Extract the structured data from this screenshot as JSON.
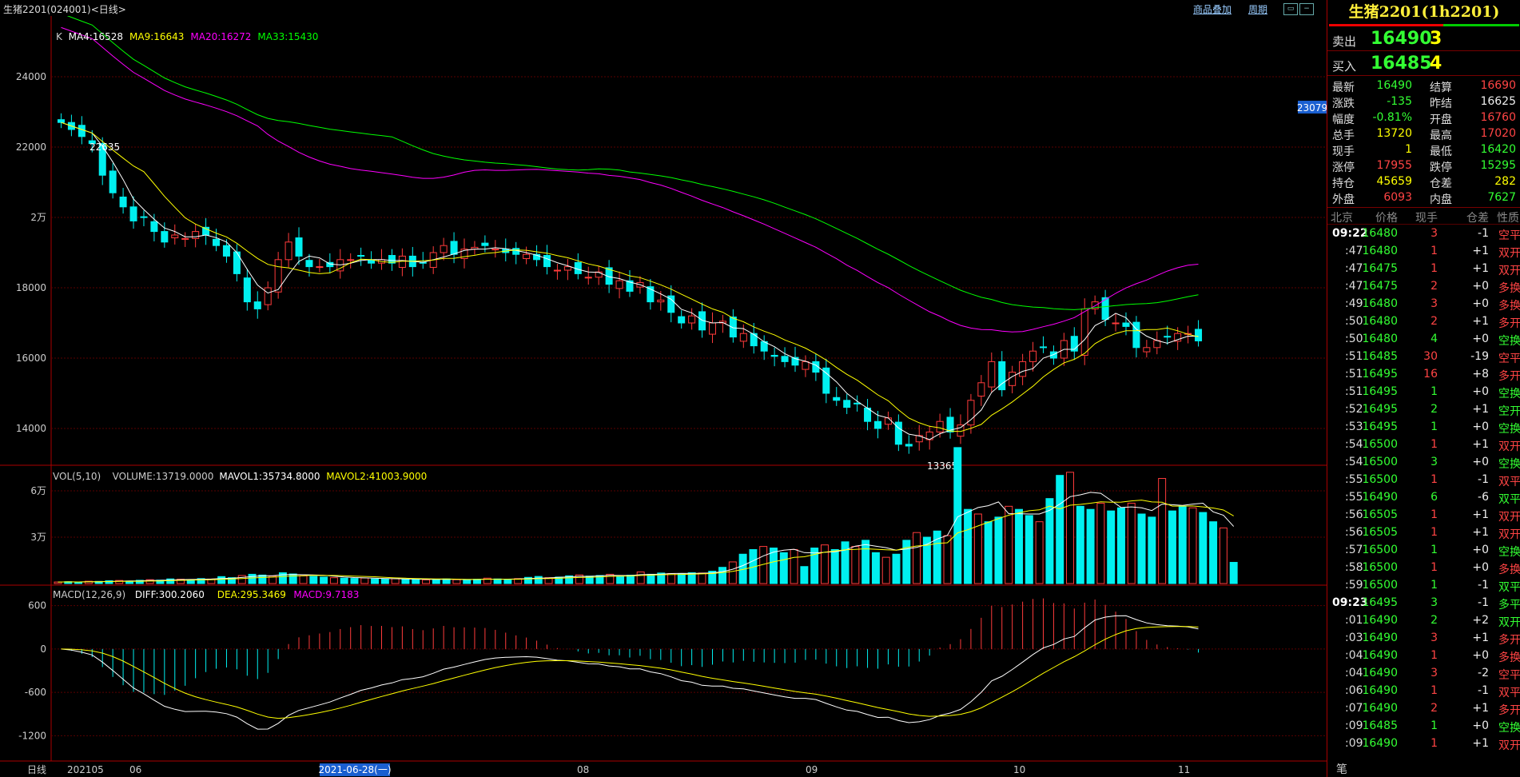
{
  "window": {
    "title": "生猪2201(024001)<日线>",
    "link_overlay": "商品叠加",
    "link_period": "周期"
  },
  "chart_data": {
    "type": "candlestick",
    "period": "日线",
    "price_axis": {
      "ticks": [
        "24000",
        "22000",
        "2万",
        "18000",
        "16000",
        "14000"
      ],
      "values": [
        24000,
        22000,
        20000,
        18000,
        16000,
        14000
      ],
      "ylim": [
        13000,
        25500
      ]
    },
    "ma_legend": [
      {
        "text": "K",
        "color": "#cccccc"
      },
      {
        "text": "MA4:16528",
        "color": "#ffffff"
      },
      {
        "text": "MA9:16643",
        "color": "#ffff00"
      },
      {
        "text": "MA20:16272",
        "color": "#ff00ff"
      },
      {
        "text": "MA33:15430",
        "color": "#00ff00"
      }
    ],
    "high_marker": "22635",
    "low_marker": "13365",
    "price_cursor": "23079",
    "closes": [
      22700,
      22500,
      22300,
      22100,
      21200,
      20700,
      20300,
      19900,
      20000,
      19600,
      19300,
      19500,
      19400,
      19600,
      19500,
      19200,
      18900,
      18400,
      17600,
      17400,
      18000,
      18800,
      19300,
      18900,
      18600,
      18600,
      18600,
      18800,
      18800,
      18900,
      18700,
      18800,
      18700,
      18900,
      18600,
      18700,
      19000,
      19200,
      18950,
      19100,
      19150,
      19200,
      19100,
      19000,
      18950,
      18950,
      18800,
      18600,
      18500,
      18600,
      18400,
      18300,
      18450,
      18100,
      18200,
      17900,
      18150,
      17600,
      17650,
      17300,
      17000,
      17200,
      16800,
      17000,
      17050,
      16600,
      16700,
      16350,
      16200,
      16050,
      15900,
      15800,
      15900,
      15600,
      15000,
      14800,
      14600,
      14700,
      14200,
      14000,
      14300,
      13550,
      13500,
      13800,
      13900,
      14200,
      13900,
      14100,
      14800,
      15300,
      15900,
      15100,
      15600,
      15900,
      16200,
      16300,
      16000,
      16500,
      16200,
      17400,
      17600,
      17100,
      17000,
      16900,
      16300,
      16300,
      16500,
      16600,
      16700,
      16700,
      16490
    ],
    "volume_panel": {
      "legend": [
        {
          "text": "VOL(5,10)",
          "color": "#cccccc"
        },
        {
          "text": "VOLUME:13719.0000",
          "color": "#cccccc"
        },
        {
          "text": "MAVOL1:35734.8000",
          "color": "#ffffff"
        },
        {
          "text": "MAVOL2:41003.9000",
          "color": "#ffff00"
        }
      ],
      "ticks": [
        "6万",
        "3万"
      ],
      "values": [
        60000,
        30000
      ],
      "ylim": [
        0,
        75000
      ],
      "volumes": [
        1000,
        1200,
        900,
        1500,
        1400,
        1800,
        2000,
        1600,
        2100,
        2500,
        2200,
        3000,
        2800,
        2600,
        3200,
        2900,
        4500,
        3800,
        5200,
        6000,
        5500,
        4800,
        7000,
        6200,
        5000,
        4600,
        4200,
        3800,
        3500,
        3300,
        3600,
        3000,
        2800,
        3100,
        2600,
        2900,
        2400,
        2700,
        3000,
        2500,
        2300,
        2800,
        3500,
        3000,
        2600,
        3200,
        4000,
        4600,
        3800,
        4200,
        5000,
        5600,
        4800,
        5200,
        6000,
        4500,
        5400,
        7500,
        6000,
        6800,
        6500,
        6200,
        7000,
        6800,
        8000,
        10500,
        14000,
        19000,
        22000,
        24000,
        23000,
        20000,
        22000,
        11000,
        23000,
        25000,
        22000,
        27000,
        24000,
        28000,
        20000,
        17000,
        19000,
        28000,
        33000,
        30000,
        34000,
        31000,
        88000,
        48000,
        45000,
        40000,
        43000,
        50000,
        48000,
        44000,
        40000,
        55000,
        70000,
        72000,
        50000,
        48000,
        52000,
        47000,
        49000,
        52000,
        45000,
        43000,
        68000,
        47000,
        50000,
        49000,
        46000,
        40000,
        36000,
        13719
      ]
    },
    "macd_panel": {
      "legend": [
        {
          "text": "MACD(12,26,9)",
          "color": "#cccccc"
        },
        {
          "text": "DIFF:300.2060",
          "color": "#ffffff"
        },
        {
          "text": "DEA:295.3469",
          "color": "#ffff00"
        },
        {
          "text": "MACD:9.7183",
          "color": "#ff00ff"
        }
      ],
      "ticks": [
        "600",
        "0",
        "-600",
        "-1200"
      ],
      "values": [
        600,
        0,
        -600,
        -1200
      ],
      "ylim": [
        -1550,
        850
      ]
    },
    "x_axis": {
      "labels": [
        "日线",
        "202105",
        "06",
        "08",
        "09",
        "10",
        "11"
      ],
      "cursor_date": "2021-06-28(一)"
    }
  },
  "quote": {
    "title": "生猪2201(1h2201)",
    "sell": {
      "label": "卖出",
      "price": "16490",
      "vol": "3"
    },
    "buy": {
      "label": "买入",
      "price": "16485",
      "vol": "4"
    },
    "stats": [
      [
        {
          "k": "最新",
          "v": "16490",
          "c": "#3f3"
        },
        {
          "k": "结算",
          "v": "16690",
          "c": "#f44"
        }
      ],
      [
        {
          "k": "涨跌",
          "v": "-135",
          "c": "#3f3"
        },
        {
          "k": "昨结",
          "v": "16625",
          "c": "#eee"
        }
      ],
      [
        {
          "k": "幅度",
          "v": "-0.81%",
          "c": "#3f3"
        },
        {
          "k": "开盘",
          "v": "16760",
          "c": "#f44"
        }
      ],
      [
        {
          "k": "总手",
          "v": "13720",
          "c": "#ff0"
        },
        {
          "k": "最高",
          "v": "17020",
          "c": "#f44"
        }
      ],
      [
        {
          "k": "现手",
          "v": "1",
          "c": "#ff0"
        },
        {
          "k": "最低",
          "v": "16420",
          "c": "#3f3"
        }
      ],
      [
        {
          "k": "涨停",
          "v": "17955",
          "c": "#f44"
        },
        {
          "k": "跌停",
          "v": "15295",
          "c": "#3f3"
        }
      ],
      [
        {
          "k": "持仓",
          "v": "45659",
          "c": "#ff0"
        },
        {
          "k": "仓差",
          "v": "282",
          "c": "#ff0"
        }
      ],
      [
        {
          "k": "外盘",
          "v": "6093",
          "c": "#f44"
        },
        {
          "k": "内盘",
          "v": "7627",
          "c": "#3f3"
        }
      ]
    ],
    "tick_header": [
      "北京",
      "价格",
      "现手",
      "仓差",
      "性质"
    ],
    "ticks": [
      {
        "t": "09:22",
        "p": "16480",
        "v": "3",
        "d": "-1",
        "n": "空平",
        "vc": "#f44",
        "nc": "#f44"
      },
      {
        "t": ":47",
        "p": "16480",
        "v": "1",
        "d": "+1",
        "n": "双开",
        "vc": "#f44",
        "nc": "#f44"
      },
      {
        "t": ":47",
        "p": "16475",
        "v": "1",
        "d": "+1",
        "n": "双开",
        "vc": "#f44",
        "nc": "#f44"
      },
      {
        "t": ":47",
        "p": "16475",
        "v": "2",
        "d": "+0",
        "n": "多换",
        "vc": "#f44",
        "nc": "#f44"
      },
      {
        "t": ":49",
        "p": "16480",
        "v": "3",
        "d": "+0",
        "n": "多换",
        "vc": "#f44",
        "nc": "#f44"
      },
      {
        "t": ":50",
        "p": "16480",
        "v": "2",
        "d": "+1",
        "n": "多开",
        "vc": "#f44",
        "nc": "#f44"
      },
      {
        "t": ":50",
        "p": "16480",
        "v": "4",
        "d": "+0",
        "n": "空换",
        "vc": "#3f3",
        "nc": "#3f3"
      },
      {
        "t": ":51",
        "p": "16485",
        "v": "30",
        "d": "-19",
        "n": "空平",
        "vc": "#f44",
        "nc": "#f44"
      },
      {
        "t": ":51",
        "p": "16495",
        "v": "16",
        "d": "+8",
        "n": "多开",
        "vc": "#f44",
        "nc": "#f44"
      },
      {
        "t": ":51",
        "p": "16495",
        "v": "1",
        "d": "+0",
        "n": "空换",
        "vc": "#3f3",
        "nc": "#3f3"
      },
      {
        "t": ":52",
        "p": "16495",
        "v": "2",
        "d": "+1",
        "n": "空开",
        "vc": "#3f3",
        "nc": "#3f3"
      },
      {
        "t": ":53",
        "p": "16495",
        "v": "1",
        "d": "+0",
        "n": "空换",
        "vc": "#3f3",
        "nc": "#3f3"
      },
      {
        "t": ":54",
        "p": "16500",
        "v": "1",
        "d": "+1",
        "n": "双开",
        "vc": "#f44",
        "nc": "#f44"
      },
      {
        "t": ":54",
        "p": "16500",
        "v": "3",
        "d": "+0",
        "n": "空换",
        "vc": "#3f3",
        "nc": "#3f3"
      },
      {
        "t": ":55",
        "p": "16500",
        "v": "1",
        "d": "-1",
        "n": "双平",
        "vc": "#f44",
        "nc": "#f44"
      },
      {
        "t": ":55",
        "p": "16490",
        "v": "6",
        "d": "-6",
        "n": "双平",
        "vc": "#3f3",
        "nc": "#3f3"
      },
      {
        "t": ":56",
        "p": "16505",
        "v": "1",
        "d": "+1",
        "n": "双开",
        "vc": "#f44",
        "nc": "#f44"
      },
      {
        "t": ":56",
        "p": "16505",
        "v": "1",
        "d": "+1",
        "n": "双开",
        "vc": "#f44",
        "nc": "#f44"
      },
      {
        "t": ":57",
        "p": "16500",
        "v": "1",
        "d": "+0",
        "n": "空换",
        "vc": "#3f3",
        "nc": "#3f3"
      },
      {
        "t": ":58",
        "p": "16500",
        "v": "1",
        "d": "+0",
        "n": "多换",
        "vc": "#f44",
        "nc": "#f44"
      },
      {
        "t": ":59",
        "p": "16500",
        "v": "1",
        "d": "-1",
        "n": "双平",
        "vc": "#3f3",
        "nc": "#3f3"
      },
      {
        "t": "09:23",
        "p": "16495",
        "v": "3",
        "d": "-1",
        "n": "多平",
        "vc": "#3f3",
        "nc": "#3f3"
      },
      {
        "t": ":01",
        "p": "16490",
        "v": "2",
        "d": "+2",
        "n": "双开",
        "vc": "#3f3",
        "nc": "#3f3"
      },
      {
        "t": ":03",
        "p": "16490",
        "v": "3",
        "d": "+1",
        "n": "多开",
        "vc": "#f44",
        "nc": "#f44"
      },
      {
        "t": ":04",
        "p": "16490",
        "v": "1",
        "d": "+0",
        "n": "多换",
        "vc": "#f44",
        "nc": "#f44"
      },
      {
        "t": ":04",
        "p": "16490",
        "v": "3",
        "d": "-2",
        "n": "空平",
        "vc": "#f44",
        "nc": "#f44"
      },
      {
        "t": ":06",
        "p": "16490",
        "v": "1",
        "d": "-1",
        "n": "双平",
        "vc": "#f44",
        "nc": "#f44"
      },
      {
        "t": ":07",
        "p": "16490",
        "v": "2",
        "d": "+1",
        "n": "多开",
        "vc": "#f44",
        "nc": "#f44"
      },
      {
        "t": ":09",
        "p": "16485",
        "v": "1",
        "d": "+0",
        "n": "空换",
        "vc": "#3f3",
        "nc": "#3f3"
      },
      {
        "t": ":09",
        "p": "16490",
        "v": "1",
        "d": "+1",
        "n": "双开",
        "vc": "#f44",
        "nc": "#f44"
      }
    ],
    "bottom_tab": "笔"
  }
}
